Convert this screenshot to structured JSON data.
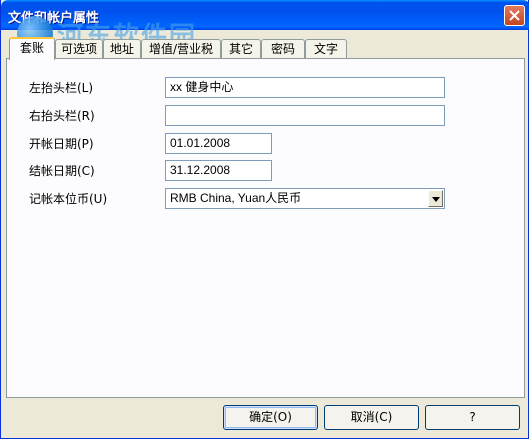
{
  "window": {
    "title": "文件和帐户属性"
  },
  "watermark": {
    "name": "河东软件园",
    "url": "www.pc0359.cn"
  },
  "tabs": [
    {
      "label": "套账",
      "active": true
    },
    {
      "label": "可选项",
      "active": false
    },
    {
      "label": "地址",
      "active": false
    },
    {
      "label": "增值/营业税",
      "active": false
    },
    {
      "label": "其它",
      "active": false
    },
    {
      "label": "密码",
      "active": false
    },
    {
      "label": "文字",
      "active": false
    }
  ],
  "form": {
    "left_header_label": "左抬头栏(L)",
    "left_header_value": "xx 健身中心",
    "right_header_label": "右抬头栏(R)",
    "right_header_value": "",
    "open_date_label": "开帐日期(P)",
    "open_date_value": "01.01.2008",
    "close_date_label": "结帐日期(C)",
    "close_date_value": "31.12.2008",
    "currency_label": "记帐本位币(U)",
    "currency_value": "RMB China, Yuan人民币"
  },
  "buttons": {
    "ok": "确定(O)",
    "cancel": "取消(C)",
    "help": "?"
  },
  "colors": {
    "titlebar": "#0054e3",
    "dialog_bg": "#ece9d8",
    "active_tab_accent": "#ffc83c"
  }
}
